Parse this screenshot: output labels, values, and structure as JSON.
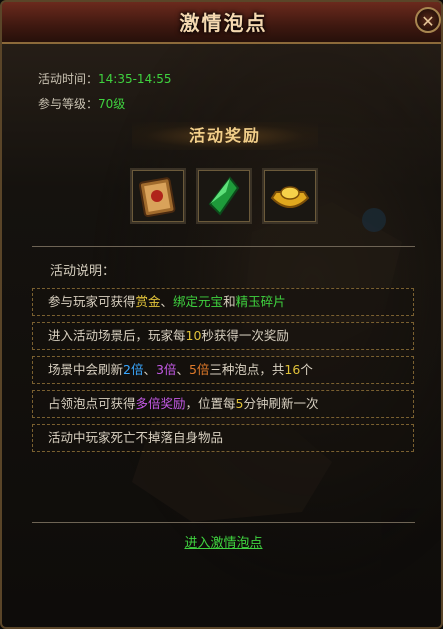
{
  "window": {
    "title": "激情泡点",
    "close_glyph": "✕"
  },
  "info": {
    "time_label": "活动时间：",
    "time_value": "14:35-14:55",
    "level_label": "参与等级：",
    "level_value": "70级"
  },
  "reward": {
    "heading": "活动奖励",
    "items": [
      {
        "icon": "scroll-icon"
      },
      {
        "icon": "green-crystal-icon"
      },
      {
        "icon": "gold-ingot-icon"
      }
    ]
  },
  "description": {
    "heading": "活动说明：",
    "lines": [
      {
        "parts": [
          [
            "参与玩家可获得",
            ""
          ],
          [
            "赏金",
            "y"
          ],
          [
            "、",
            ""
          ],
          [
            "绑定元宝",
            "g"
          ],
          [
            "和",
            ""
          ],
          [
            "精玉碎片",
            "g"
          ]
        ]
      },
      {
        "parts": [
          [
            "进入活动场景后，玩家每",
            ""
          ],
          [
            "10",
            "y"
          ],
          [
            "秒获得一次奖励",
            ""
          ]
        ]
      },
      {
        "parts": [
          [
            "场景中会刷新",
            ""
          ],
          [
            "2倍",
            "b"
          ],
          [
            "、",
            ""
          ],
          [
            "3倍",
            "p"
          ],
          [
            "、",
            ""
          ],
          [
            "5倍",
            "o"
          ],
          [
            "三种泡点，共",
            ""
          ],
          [
            "16",
            "y"
          ],
          [
            "个",
            ""
          ]
        ]
      },
      {
        "parts": [
          [
            "占领泡点可获得",
            ""
          ],
          [
            "多倍奖励",
            "p"
          ],
          [
            "，位置每",
            ""
          ],
          [
            "5",
            "y"
          ],
          [
            "分钟刷新一次",
            ""
          ]
        ]
      },
      {
        "parts": [
          [
            "活动中玩家死亡不掉落自身物品",
            ""
          ]
        ]
      }
    ]
  },
  "enter_link": "进入激情泡点",
  "colors": {
    "highlight_yellow": "#e0c23a",
    "green": "#3fd23f",
    "blue": "#3aa8ff",
    "purple": "#c45ae6",
    "orange": "#e07a2a"
  }
}
